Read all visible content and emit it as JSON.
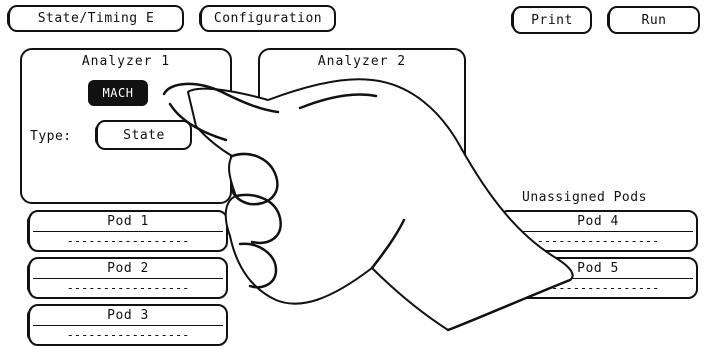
{
  "toolbar": {
    "menu_label": "State/Timing E",
    "configuration_label": "Configuration",
    "print_label": "Print",
    "run_label": "Run"
  },
  "analyzer1": {
    "title": "Analyzer 1",
    "name_button": "MACH",
    "type_label": "Type:",
    "type_value": "State"
  },
  "analyzer2": {
    "title": "Analyzer 2"
  },
  "pods_assigned": [
    {
      "label": "Pod 1",
      "bits": "-----------------"
    },
    {
      "label": "Pod 2",
      "bits": "-----------------"
    },
    {
      "label": "Pod 3",
      "bits": "-----------------"
    }
  ],
  "unassigned": {
    "title": "Unassigned Pods",
    "pods": [
      {
        "label": "Pod 4",
        "bits": "-----------------"
      },
      {
        "label": "Pod 5",
        "bits": "-----------------"
      }
    ]
  },
  "overlay": {
    "icon": "pointing-hand-icon"
  }
}
